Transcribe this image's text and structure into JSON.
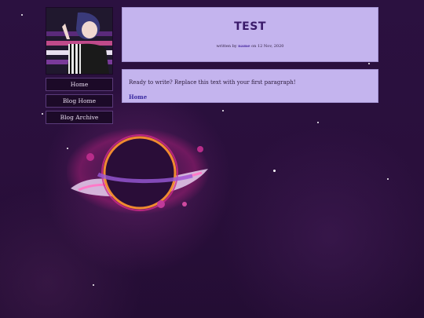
{
  "sidebar": {
    "nav": [
      {
        "label": "Home"
      },
      {
        "label": "Blog Home"
      },
      {
        "label": "Blog Archive"
      }
    ]
  },
  "post": {
    "title": "TEST",
    "byline_prefix": "written by",
    "author": "name",
    "byline_on": "on",
    "date": "12 Nov, 2020",
    "paragraph": "Ready to write? Replace this text with your first paragraph!",
    "home_link": "Home"
  },
  "colors": {
    "panel": "#c4b4ee",
    "title": "#3a1a6a",
    "background": "#2a0f3d",
    "nav_bg": "#1c0a28"
  }
}
